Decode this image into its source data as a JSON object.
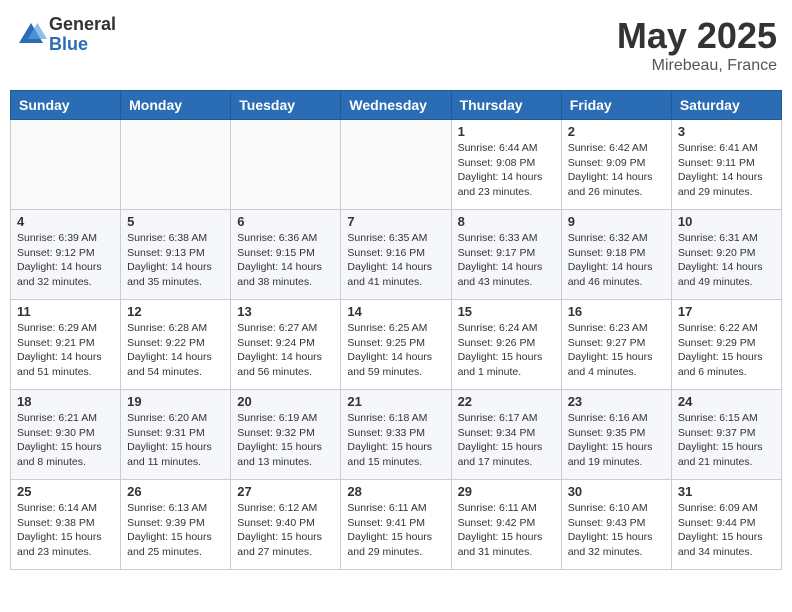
{
  "logo": {
    "general": "General",
    "blue": "Blue"
  },
  "title": {
    "month_year": "May 2025",
    "location": "Mirebeau, France"
  },
  "headers": [
    "Sunday",
    "Monday",
    "Tuesday",
    "Wednesday",
    "Thursday",
    "Friday",
    "Saturday"
  ],
  "weeks": [
    [
      {
        "day": "",
        "info": ""
      },
      {
        "day": "",
        "info": ""
      },
      {
        "day": "",
        "info": ""
      },
      {
        "day": "",
        "info": ""
      },
      {
        "day": "1",
        "info": "Sunrise: 6:44 AM\nSunset: 9:08 PM\nDaylight: 14 hours\nand 23 minutes."
      },
      {
        "day": "2",
        "info": "Sunrise: 6:42 AM\nSunset: 9:09 PM\nDaylight: 14 hours\nand 26 minutes."
      },
      {
        "day": "3",
        "info": "Sunrise: 6:41 AM\nSunset: 9:11 PM\nDaylight: 14 hours\nand 29 minutes."
      }
    ],
    [
      {
        "day": "4",
        "info": "Sunrise: 6:39 AM\nSunset: 9:12 PM\nDaylight: 14 hours\nand 32 minutes."
      },
      {
        "day": "5",
        "info": "Sunrise: 6:38 AM\nSunset: 9:13 PM\nDaylight: 14 hours\nand 35 minutes."
      },
      {
        "day": "6",
        "info": "Sunrise: 6:36 AM\nSunset: 9:15 PM\nDaylight: 14 hours\nand 38 minutes."
      },
      {
        "day": "7",
        "info": "Sunrise: 6:35 AM\nSunset: 9:16 PM\nDaylight: 14 hours\nand 41 minutes."
      },
      {
        "day": "8",
        "info": "Sunrise: 6:33 AM\nSunset: 9:17 PM\nDaylight: 14 hours\nand 43 minutes."
      },
      {
        "day": "9",
        "info": "Sunrise: 6:32 AM\nSunset: 9:18 PM\nDaylight: 14 hours\nand 46 minutes."
      },
      {
        "day": "10",
        "info": "Sunrise: 6:31 AM\nSunset: 9:20 PM\nDaylight: 14 hours\nand 49 minutes."
      }
    ],
    [
      {
        "day": "11",
        "info": "Sunrise: 6:29 AM\nSunset: 9:21 PM\nDaylight: 14 hours\nand 51 minutes."
      },
      {
        "day": "12",
        "info": "Sunrise: 6:28 AM\nSunset: 9:22 PM\nDaylight: 14 hours\nand 54 minutes."
      },
      {
        "day": "13",
        "info": "Sunrise: 6:27 AM\nSunset: 9:24 PM\nDaylight: 14 hours\nand 56 minutes."
      },
      {
        "day": "14",
        "info": "Sunrise: 6:25 AM\nSunset: 9:25 PM\nDaylight: 14 hours\nand 59 minutes."
      },
      {
        "day": "15",
        "info": "Sunrise: 6:24 AM\nSunset: 9:26 PM\nDaylight: 15 hours\nand 1 minute."
      },
      {
        "day": "16",
        "info": "Sunrise: 6:23 AM\nSunset: 9:27 PM\nDaylight: 15 hours\nand 4 minutes."
      },
      {
        "day": "17",
        "info": "Sunrise: 6:22 AM\nSunset: 9:29 PM\nDaylight: 15 hours\nand 6 minutes."
      }
    ],
    [
      {
        "day": "18",
        "info": "Sunrise: 6:21 AM\nSunset: 9:30 PM\nDaylight: 15 hours\nand 8 minutes."
      },
      {
        "day": "19",
        "info": "Sunrise: 6:20 AM\nSunset: 9:31 PM\nDaylight: 15 hours\nand 11 minutes."
      },
      {
        "day": "20",
        "info": "Sunrise: 6:19 AM\nSunset: 9:32 PM\nDaylight: 15 hours\nand 13 minutes."
      },
      {
        "day": "21",
        "info": "Sunrise: 6:18 AM\nSunset: 9:33 PM\nDaylight: 15 hours\nand 15 minutes."
      },
      {
        "day": "22",
        "info": "Sunrise: 6:17 AM\nSunset: 9:34 PM\nDaylight: 15 hours\nand 17 minutes."
      },
      {
        "day": "23",
        "info": "Sunrise: 6:16 AM\nSunset: 9:35 PM\nDaylight: 15 hours\nand 19 minutes."
      },
      {
        "day": "24",
        "info": "Sunrise: 6:15 AM\nSunset: 9:37 PM\nDaylight: 15 hours\nand 21 minutes."
      }
    ],
    [
      {
        "day": "25",
        "info": "Sunrise: 6:14 AM\nSunset: 9:38 PM\nDaylight: 15 hours\nand 23 minutes."
      },
      {
        "day": "26",
        "info": "Sunrise: 6:13 AM\nSunset: 9:39 PM\nDaylight: 15 hours\nand 25 minutes."
      },
      {
        "day": "27",
        "info": "Sunrise: 6:12 AM\nSunset: 9:40 PM\nDaylight: 15 hours\nand 27 minutes."
      },
      {
        "day": "28",
        "info": "Sunrise: 6:11 AM\nSunset: 9:41 PM\nDaylight: 15 hours\nand 29 minutes."
      },
      {
        "day": "29",
        "info": "Sunrise: 6:11 AM\nSunset: 9:42 PM\nDaylight: 15 hours\nand 31 minutes."
      },
      {
        "day": "30",
        "info": "Sunrise: 6:10 AM\nSunset: 9:43 PM\nDaylight: 15 hours\nand 32 minutes."
      },
      {
        "day": "31",
        "info": "Sunrise: 6:09 AM\nSunset: 9:44 PM\nDaylight: 15 hours\nand 34 minutes."
      }
    ]
  ]
}
